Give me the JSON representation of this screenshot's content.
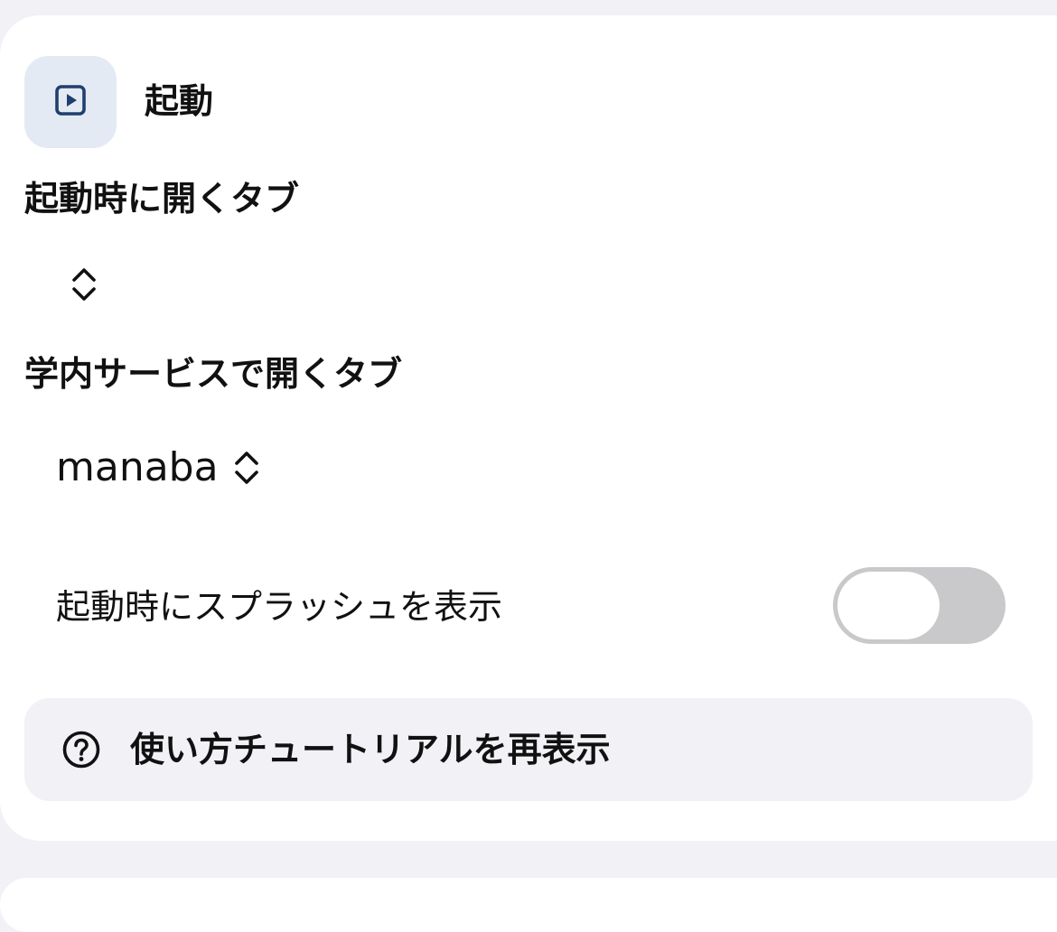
{
  "section": {
    "title": "起動",
    "icon": "play-square-icon",
    "icon_color": "#1f3f6e"
  },
  "startup_tab": {
    "label": "起動時に開くタブ",
    "selected": ""
  },
  "campus_tab": {
    "label": "学内サービスで開くタブ",
    "selected": "manaba"
  },
  "splash": {
    "label": "起動時にスプラッシュを表示",
    "enabled": false
  },
  "tutorial": {
    "label": "使い方チュートリアルを再表示",
    "icon": "question-circle-icon"
  },
  "colors": {
    "background": "#f1f1f6",
    "card": "#ffffff",
    "icon_box": "#e4eaf3",
    "toggle_off": "#c9c9cb"
  }
}
